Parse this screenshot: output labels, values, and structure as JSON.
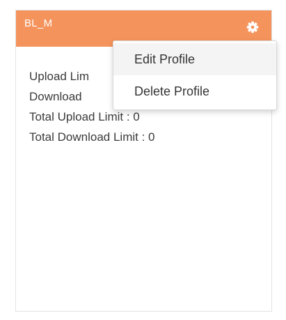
{
  "profile_card": {
    "title": "BL_M",
    "header_color": "#f5935c",
    "settings_icon": "gear-icon",
    "lines": [
      "Upload Lim",
      "Download",
      "Total Upload Limit : 0",
      "Total Download Limit : 0"
    ]
  },
  "context_menu": {
    "items": [
      {
        "label": "Edit Profile",
        "hovered": true
      },
      {
        "label": "Delete Profile",
        "hovered": false
      }
    ]
  }
}
